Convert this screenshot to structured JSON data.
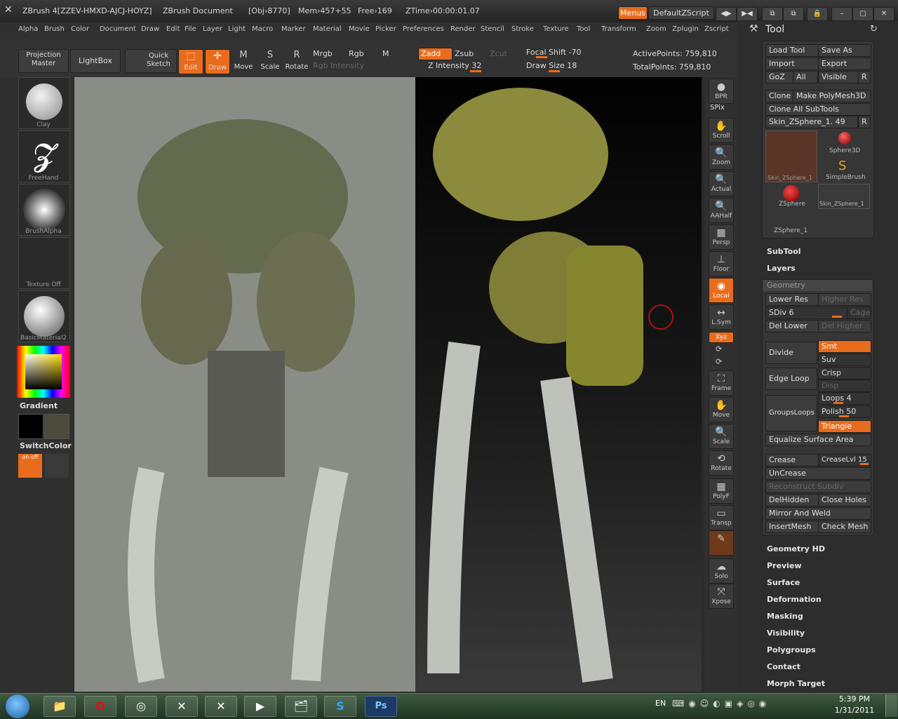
{
  "title": {
    "app": "ZBrush 4[ZZEV-HMXD-AJCJ-HOYZ]",
    "doc": "ZBrush Document",
    "obj": "[Obj›8770]",
    "mem": "Mem›457+55",
    "free": "Free›169",
    "ztime": "ZTime›00:00:01.07",
    "menus_btn": "Menus",
    "script": "DefaultZScript"
  },
  "menus": [
    "Alpha",
    "Brush",
    "Color",
    "Document",
    "Draw",
    "Edit",
    "File",
    "Layer",
    "Light",
    "Macro",
    "Marker",
    "Material",
    "Movie",
    "Picker",
    "Preferences",
    "Render",
    "Stencil",
    "Stroke",
    "Texture",
    "Tool",
    "Transform",
    "Zoom",
    "Zplugin",
    "Zscript"
  ],
  "toolbar": {
    "projection_master": "Projection Master",
    "lightbox": "LightBox",
    "quick_sketch": "Quick Sketch",
    "edit": "Edit",
    "draw": "Draw",
    "move": "Move",
    "scale": "Scale",
    "rotate": "Rotate",
    "mrgb": "Mrgb",
    "rgb": "Rgb",
    "m": "M",
    "rgb_intensity": "Rgb Intensity",
    "zadd": "Zadd",
    "zsub": "Zsub",
    "zcut": "Zcut",
    "z_intensity": "Z Intensity 32",
    "focal_shift": "Focal Shift -70",
    "draw_size": "Draw Size 18",
    "active_points": "ActivePoints: 759,810",
    "total_points": "TotalPoints: 759,810"
  },
  "left": {
    "clay": "Clay",
    "freehand": "FreeHand",
    "brushalpha": "BrushAlpha",
    "texture_off": "Texture Off",
    "material": "BasicMaterial2",
    "gradient": "Gradient",
    "switchcolor": "SwitchColor",
    "onoff": "on off"
  },
  "rightbar": [
    "BPR",
    "SPix",
    "Scroll",
    "Zoom",
    "Actual",
    "AAHalf",
    "Persp",
    "Floor",
    "Local",
    "L.Sym",
    "Xyz",
    "Frame",
    "Move",
    "Scale",
    "Rotate",
    "PolyF",
    "Transp",
    "Solo",
    "Xpose"
  ],
  "tool": {
    "title": "Tool",
    "load_tool": "Load Tool",
    "save_as": "Save As",
    "import": "Import",
    "export": "Export",
    "goz": "GoZ",
    "all": "All",
    "visible": "Visible",
    "r": "R",
    "clone": "Clone",
    "make_polymesh": "Make PolyMesh3D",
    "clone_all": "Clone All SubTools",
    "current_tool": "Skin_ZSphere_1. 49",
    "thumbs": [
      "Skin_ZSphere_1",
      "Sphere3D",
      "SimpleBrush",
      "ZSphere",
      "Skin_ZSphere_1",
      "ZSphere_1"
    ],
    "subtool": "SubTool",
    "layers": "Layers",
    "geometry": "Geometry",
    "lower_res": "Lower Res",
    "higher_res": "Higher Res",
    "sdiv": "SDiv 6",
    "cage": "Cage",
    "del_lower": "Del Lower",
    "del_higher": "Del Higher",
    "divide": "Divide",
    "smt": "Smt",
    "suv": "Suv",
    "edge_loop": "Edge Loop",
    "crisp": "Crisp",
    "disp": "Disp",
    "groupsloops": "GroupsLoops",
    "loops": "Loops 4",
    "polish": "Polish 50",
    "triangle": "Triangle",
    "equalize": "Equalize Surface Area",
    "crease": "Crease",
    "creaselvl": "CreaseLvl 15",
    "uncrease": "UnCrease",
    "reconstruct": "Reconstruct Subdiv",
    "delhidden": "DelHidden",
    "close_holes": "Close Holes",
    "mirror_weld": "Mirror And Weld",
    "insertmesh": "InsertMesh",
    "check_mesh": "Check Mesh",
    "sections": [
      "Geometry HD",
      "Preview",
      "Surface",
      "Deformation",
      "Masking",
      "Visibility",
      "Polygroups",
      "Contact",
      "Morph Target"
    ]
  },
  "taskbar": {
    "lang": "EN",
    "time": "5:39 PM",
    "date": "1/31/2011",
    "ps": "Ps"
  }
}
